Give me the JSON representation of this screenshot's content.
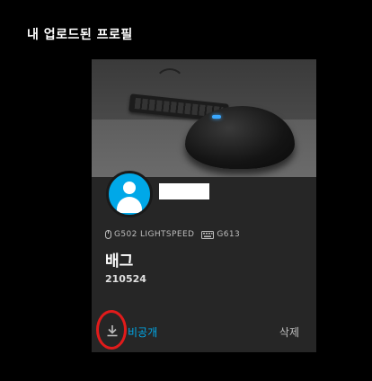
{
  "page": {
    "title": "내 업로드된 프로필"
  },
  "card": {
    "devices": [
      {
        "icon": "mouse-icon",
        "label": "G502 LIGHTSPEED"
      },
      {
        "icon": "keyboard-icon",
        "label": "G613"
      }
    ],
    "profile_name": "배그",
    "profile_sub": "210524",
    "visibility_label": "비공개",
    "delete_label": "삭제",
    "download_icon": "download-icon"
  },
  "colors": {
    "background": "#000000",
    "card": "#262626",
    "accent": "#00a8e8",
    "annotation": "#e11b1b"
  }
}
